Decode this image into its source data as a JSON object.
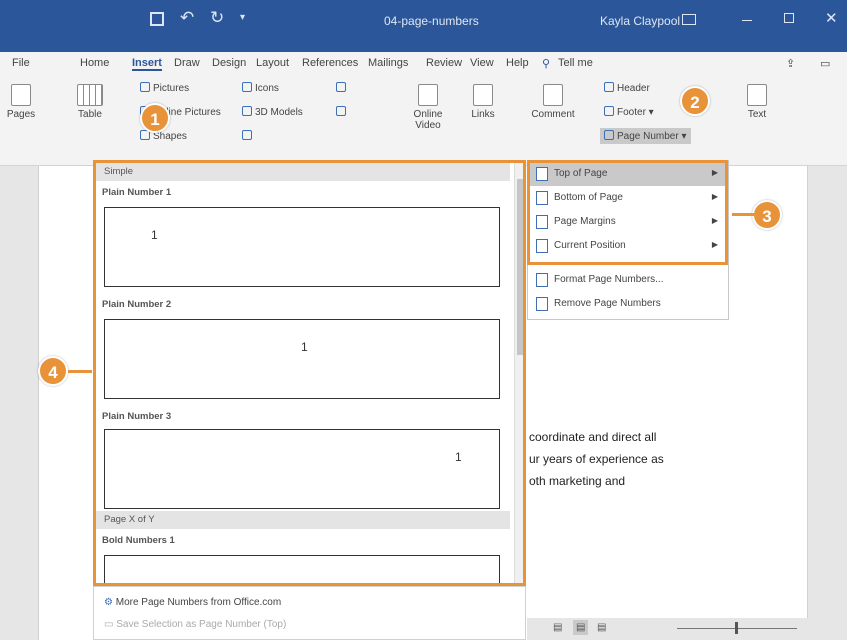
{
  "window": {
    "doc_title": "04-page-numbers",
    "user": "Kayla Claypool",
    "controls": [
      "minimize",
      "restore",
      "close"
    ]
  },
  "qat": {
    "undo": "undo",
    "redo": "redo",
    "more": "more"
  },
  "tabs": [
    "File",
    "Home",
    "Insert",
    "Draw",
    "Design",
    "Layout",
    "References",
    "Mailings",
    "Review",
    "View",
    "Help"
  ],
  "active_tab": "Insert",
  "tell_me": "Tell me",
  "ribbon": {
    "pages": "Pages",
    "table": "Table",
    "pictures": "Pictures",
    "online_pictures": "Online Pictures",
    "shapes": "Shapes",
    "icons": "Icons",
    "models": "3D Models",
    "online_video": "Online Video",
    "links": "Links",
    "comment": "Comment",
    "header": "Header",
    "footer": "Footer",
    "page_number": "Page Number",
    "text": "Text"
  },
  "gallery": {
    "section1": "Simple",
    "items": [
      {
        "label": "Plain Number 1"
      },
      {
        "label": "Plain Number 2"
      },
      {
        "label": "Plain Number 3"
      }
    ],
    "section2": "Page X of Y",
    "item4": "Bold Numbers 1",
    "more": "More Page Numbers from Office.com",
    "save": "Save Selection as Page Number (Top)"
  },
  "submenu": {
    "items": [
      "Top of Page",
      "Bottom of Page",
      "Page Margins",
      "Current Position"
    ],
    "format": "Format Page Numbers...",
    "remove": "Remove Page Numbers"
  },
  "badges": {
    "b1": "1",
    "b2": "2",
    "b3": "3",
    "b4": "4"
  },
  "body_lines": [
    "coordinate and direct all",
    "ur years of experience as",
    "oth marketing and"
  ],
  "colors": {
    "title_bar": "#2b579a",
    "highlight": "#e8933a",
    "ribbon": "#f3f3f3"
  }
}
